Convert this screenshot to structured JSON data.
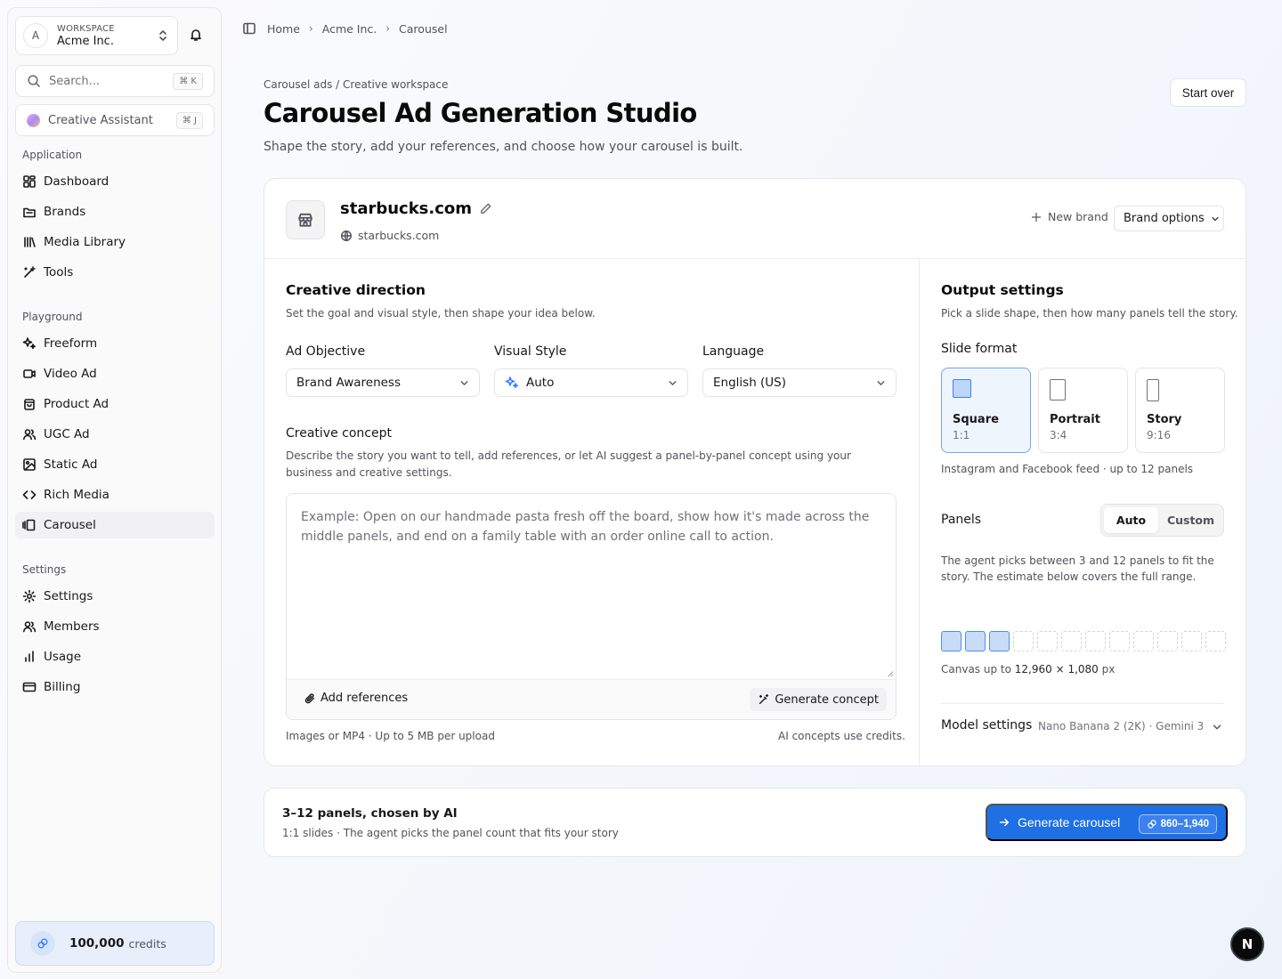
{
  "sidebar": {
    "workspace": {
      "label": "WORKSPACE",
      "name": "Acme Inc.",
      "avatar": "A"
    },
    "search": {
      "placeholder": "Search...",
      "shortcut": "⌘ K"
    },
    "assistant": {
      "label": "Creative Assistant",
      "shortcut": "⌘ J"
    },
    "groups": [
      {
        "title": "Application",
        "items": [
          {
            "label": "Dashboard",
            "icon": "dashboard-icon"
          },
          {
            "label": "Brands",
            "icon": "folder-icon"
          },
          {
            "label": "Media Library",
            "icon": "library-icon"
          },
          {
            "label": "Tools",
            "icon": "wand-icon"
          }
        ]
      },
      {
        "title": "Playground",
        "items": [
          {
            "label": "Freeform",
            "icon": "sparkles-icon"
          },
          {
            "label": "Video Ad",
            "icon": "video-icon"
          },
          {
            "label": "Product Ad",
            "icon": "bag-icon"
          },
          {
            "label": "UGC Ad",
            "icon": "users-icon"
          },
          {
            "label": "Static Ad",
            "icon": "image-icon"
          },
          {
            "label": "Rich Media",
            "icon": "code-icon"
          },
          {
            "label": "Carousel",
            "icon": "carousel-icon",
            "active": true
          }
        ]
      },
      {
        "title": "Settings",
        "items": [
          {
            "label": "Settings",
            "icon": "gear-icon"
          },
          {
            "label": "Members",
            "icon": "users-icon"
          },
          {
            "label": "Usage",
            "icon": "bar-chart-icon"
          },
          {
            "label": "Billing",
            "icon": "credit-card-icon"
          }
        ]
      }
    ],
    "credits": {
      "amount": "100,000",
      "label": "credits"
    }
  },
  "breadcrumb": [
    "Home",
    "Acme Inc.",
    "Carousel"
  ],
  "header": {
    "eyebrow": "Carousel ads / Creative workspace",
    "title": "Carousel Ad Generation Studio",
    "description": "Shape the story, add your references, and choose how your carousel is built.",
    "start_over": "Start over"
  },
  "brand": {
    "name": "starbucks.com",
    "url": "starbucks.com",
    "new_brand": "New brand",
    "options": "Brand options"
  },
  "creative": {
    "title": "Creative direction",
    "description": "Set the goal and visual style, then shape your idea below.",
    "objective": {
      "label": "Ad Objective",
      "value": "Brand Awareness"
    },
    "style": {
      "label": "Visual Style",
      "value": "Auto"
    },
    "language": {
      "label": "Language",
      "value": "English (US)"
    },
    "concept": {
      "label": "Creative concept",
      "description": "Describe the story you want to tell, add references, or let AI suggest a panel-by-panel concept using your business and creative settings.",
      "placeholder": "Example: Open on our handmade pasta fresh off the board, show how it's made across the middle panels, and end on a family table with an order online call to action.",
      "add_references": "Add references",
      "generate_concept": "Generate concept"
    },
    "upload_note": "Images or MP4 · Up to 5 MB per upload",
    "credits_note": "AI concepts use credits."
  },
  "output": {
    "title": "Output settings",
    "description": "Pick a slide shape, then how many panels tell the story.",
    "slide_format_label": "Slide format",
    "formats": [
      {
        "name": "Square",
        "ratio": "1:1",
        "selected": true
      },
      {
        "name": "Portrait",
        "ratio": "3:4",
        "selected": false
      },
      {
        "name": "Story",
        "ratio": "9:16",
        "selected": false
      }
    ],
    "format_note": "Instagram and Facebook feed · up to 12 panels",
    "panels_label": "Panels",
    "panel_modes": [
      "Auto",
      "Custom"
    ],
    "panel_mode_selected": "Auto",
    "panel_desc": "The agent picks between 3 and 12 panels to fit the story. The estimate below covers the full range.",
    "panels_filled": 3,
    "panels_total": 12,
    "canvas_prefix": "Canvas up to",
    "canvas_size": "12,960 × 1,080",
    "canvas_unit": "px",
    "model_label": "Model settings",
    "model_value": "Nano Banana 2 (2K) · Gemini 3..."
  },
  "summary": {
    "title": "3–12 panels, chosen by AI",
    "subtitle": "1:1 slides · The agent picks the panel count that fits your story",
    "generate_label": "Generate carousel",
    "cost": "860–1,940"
  },
  "colors": {
    "accent": "#1f6fe5",
    "selected_fill": "#eff5fd",
    "credits_bg": "#e8effb"
  },
  "dev_badge": "N"
}
